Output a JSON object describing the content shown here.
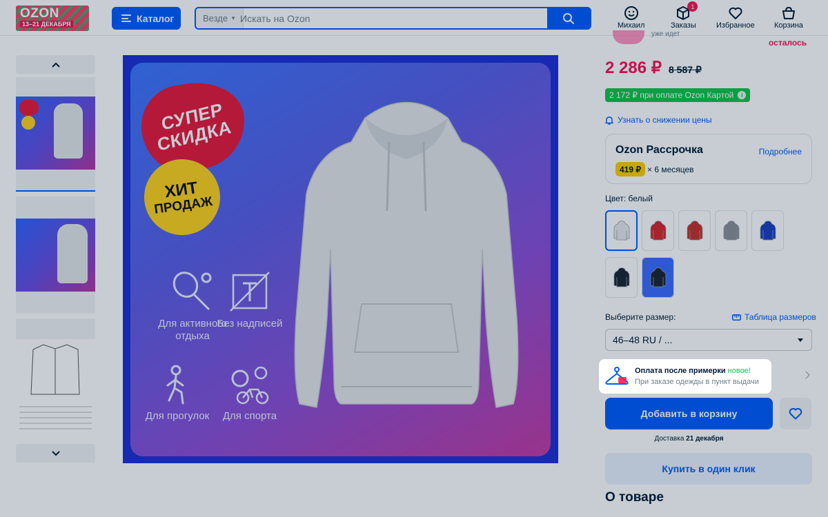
{
  "header": {
    "logo": {
      "brand": "OZON",
      "dates": "13–21 ДЕКАБРЯ"
    },
    "catalog_label": "Каталог",
    "search": {
      "scope": "Везде",
      "placeholder": "Искать на Ozon"
    },
    "user_label": "Михаил",
    "orders_label": "Заказы",
    "orders_badge": "1",
    "favorites_label": "Избранное",
    "cart_label": "Корзина"
  },
  "gallery": {
    "main_image": {
      "promo_top": "СУПЕР СКИДКА",
      "promo_top_line1": "СУПЕР",
      "promo_top_line2": "СКИДКА",
      "promo_hit_line1": "ХИТ",
      "promo_hit_line2": "ПРОДАЖ",
      "features": {
        "active": "Для активного отдыха",
        "no_print": "Без надписей",
        "walks": "Для прогулок",
        "sport": "Для спорта"
      }
    }
  },
  "product": {
    "stock_left": "осталось",
    "already": "уже идет",
    "price": "2 286 ₽",
    "old_price": "8 587 ₽",
    "ozon_card_price": "2 172 ₽ при оплате Ozon Картой",
    "notify_label": "Узнать о снижении цены",
    "installment": {
      "title": "Ozon Рассрочка",
      "more": "Подробнее",
      "amount": "419 ₽",
      "months": "× 6 месяцев"
    },
    "color_label": "Цвет: белый",
    "colors": [
      "#e7e9ec",
      "#d8262c",
      "#c9302a",
      "#8c8f94",
      "#1d3fc2",
      "#1b2433",
      "#1b2433"
    ],
    "size_label": "Выберите размер:",
    "size_table": "Таблица размеров",
    "size_selected": "46–48 RU / ...",
    "fitting": {
      "title": "Оплата после примерки",
      "new": "новое!",
      "subtitle": "При заказе одежды в пункт выдачи"
    },
    "add_to_cart": "Добавить в корзину",
    "delivery_prefix": "Доставка",
    "delivery_date": "21 декабря",
    "buy_one_click": "Купить в один клик",
    "about": "О товаре"
  },
  "colors": {
    "accent": "#005bff",
    "price": "#f91155",
    "card_green": "#10c44c",
    "installment_yellow": "#ffcd00"
  }
}
